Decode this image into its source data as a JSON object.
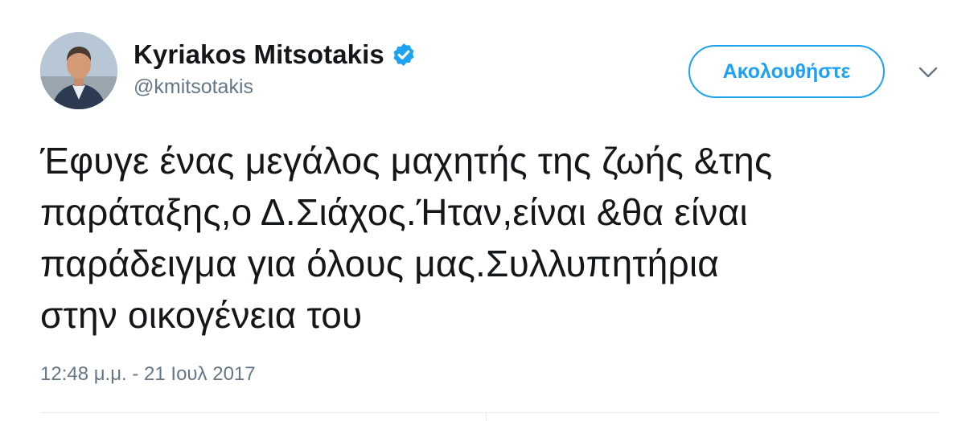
{
  "tweet": {
    "author": {
      "display_name": "Kyriakos Mitsotakis",
      "handle": "@kmitsotakis",
      "verified": true
    },
    "follow_button_label": "Ακολουθήστε",
    "text": "Έφυγε ένας μεγάλος μαχητής της ζωής &της\nπαράταξης,ο Δ.Σιάχος.Ήταν,είναι &θα είναι\nπαράδειγμα για όλους μας.Συλλυπητήρια\nστην οικογένεια του",
    "timestamp": "12:48 μ.μ. - 21 Ιουλ 2017"
  },
  "icons": {
    "verified": "verified-badge-icon",
    "menu": "chevron-down-icon"
  },
  "colors": {
    "accent": "#1da1f2",
    "text_primary": "#14171a",
    "text_secondary": "#657786",
    "divider": "#e6ecf0"
  }
}
